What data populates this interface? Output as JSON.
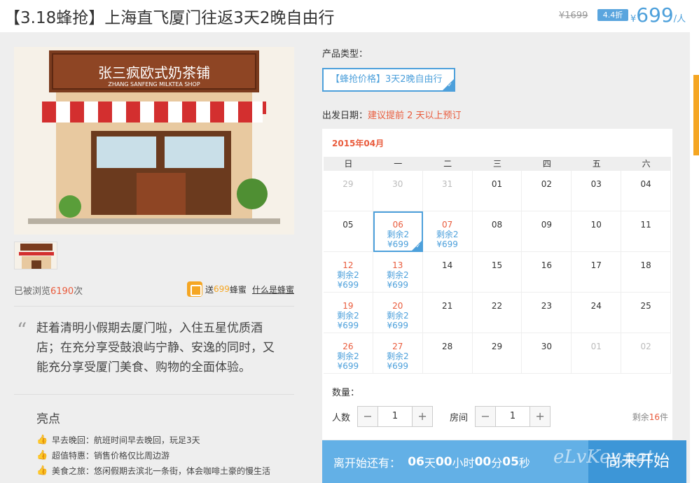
{
  "header": {
    "title": "【3.18蜂抢】上海直飞厦门往返3天2晚自由行",
    "old_price": "¥1699",
    "discount": "4.4折",
    "price_symbol": "¥",
    "price": "699",
    "price_unit": "/人"
  },
  "gallery": {
    "shop_sign_text": "张三疯欧式奶茶铺",
    "shop_sign_subtext": "ZHANG SANFENG MILKTEA SHOP"
  },
  "stats": {
    "views_prefix": "已被浏览",
    "views_count": "6190",
    "views_suffix": "次",
    "honey_prefix": "送",
    "honey_count": "699",
    "honey_suffix": "蜂蜜",
    "honey_link": "什么是蜂蜜"
  },
  "quote": {
    "mark": "“",
    "text": "赶着清明小假期去厦门啦，入住五星优质酒店；在充分享受鼓浪屿宁静、安逸的同时，又能充分享受厦门美食、购物的全面体验。"
  },
  "highlights": {
    "title": "亮点",
    "items": [
      "早去晚回：航班时间早去晚回，玩足3天",
      "超值特惠：销售价格仅比周边游",
      "美食之旅：悠闲假期去滨北一条街，体会咖啡土豪的慢生活"
    ]
  },
  "product": {
    "label": "产品类型：",
    "option": "【蜂抢价格】3天2晚自由行"
  },
  "departure": {
    "label": "出发日期：",
    "hint": "建议提前 2 天以上预订"
  },
  "calendar": {
    "month": "2015年04月",
    "weekdays": [
      "日",
      "一",
      "二",
      "三",
      "四",
      "五",
      "六"
    ],
    "stock_label": "剩余2",
    "stock_price": "¥699",
    "rows": [
      [
        "29",
        "30",
        "31",
        "01",
        "02",
        "03",
        "04"
      ],
      [
        "05",
        "06",
        "07",
        "08",
        "09",
        "10",
        "11"
      ],
      [
        "12",
        "13",
        "14",
        "15",
        "16",
        "17",
        "18"
      ],
      [
        "19",
        "20",
        "21",
        "22",
        "23",
        "24",
        "25"
      ],
      [
        "26",
        "27",
        "28",
        "29",
        "30",
        "01",
        "02"
      ]
    ]
  },
  "quantity": {
    "label": "数量：",
    "people_label": "人数",
    "people_value": "1",
    "room_label": "房间",
    "room_value": "1",
    "minus": "−",
    "plus": "+",
    "remain_prefix": "剩余",
    "remain_count": "16",
    "remain_suffix": "件"
  },
  "countdown": {
    "prefix": "离开始还有：",
    "days": "06",
    "days_unit": "天",
    "hours": "00",
    "hours_unit": "小时",
    "minutes": "00",
    "minutes_unit": "分",
    "seconds": "05",
    "seconds_unit": "秒",
    "button": "尚未开始"
  },
  "watermark": "eLvKey.net",
  "colors": {
    "accent_blue": "#4da0db",
    "accent_red": "#e95b3c",
    "accent_orange": "#f5a623"
  }
}
